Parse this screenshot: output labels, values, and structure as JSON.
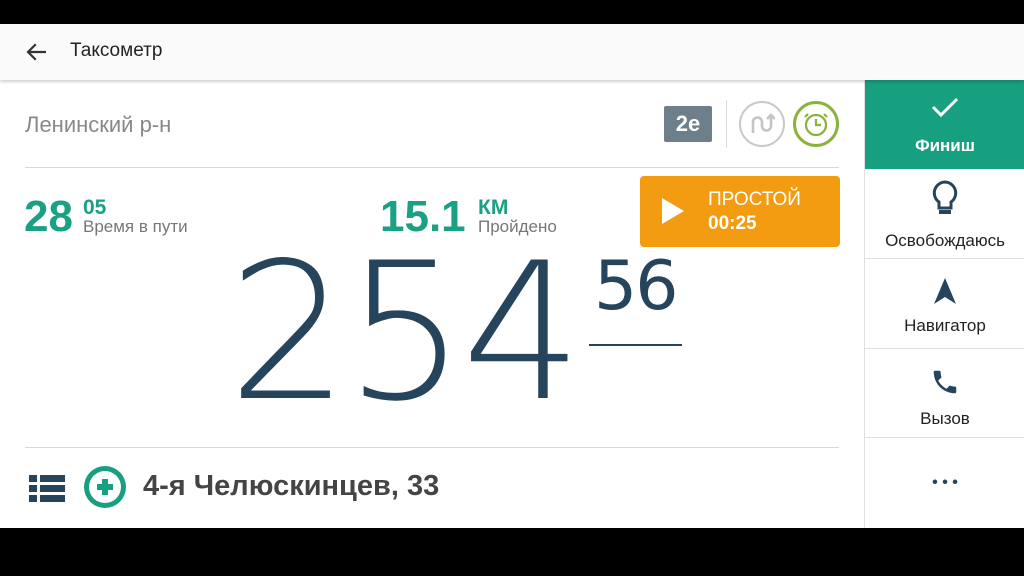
{
  "toolbar": {
    "title": "Таксометр"
  },
  "trip": {
    "district": "Ленинский р-н",
    "zone": "2е",
    "time_major": "28",
    "time_minor": "05",
    "time_label": "Время в пути",
    "distance_value": "15.1",
    "distance_unit": "КМ",
    "distance_label": "Пройдено",
    "idle_title": "ПРОСТОЙ",
    "idle_time": "00:25",
    "fare_main": "254",
    "fare_cents": "56",
    "address": "4-я Челюскинцев, 33"
  },
  "sidebar": {
    "finish": "Финиш",
    "release": "Освобождаюсь",
    "navigator": "Навигатор",
    "call": "Вызов",
    "more": "• • •"
  },
  "colors": {
    "accent": "#17a07f",
    "idle": "#f39c12",
    "fare": "#27445d",
    "badge": "#6d7f8a",
    "clock_ring": "#8bb23c"
  },
  "icons": [
    "back-arrow-icon",
    "route-icon",
    "clock-icon",
    "play-icon",
    "list-icon",
    "add-stop-icon",
    "check-icon",
    "lightbulb-icon",
    "navigation-arrow-icon",
    "phone-icon",
    "more-icon"
  ]
}
